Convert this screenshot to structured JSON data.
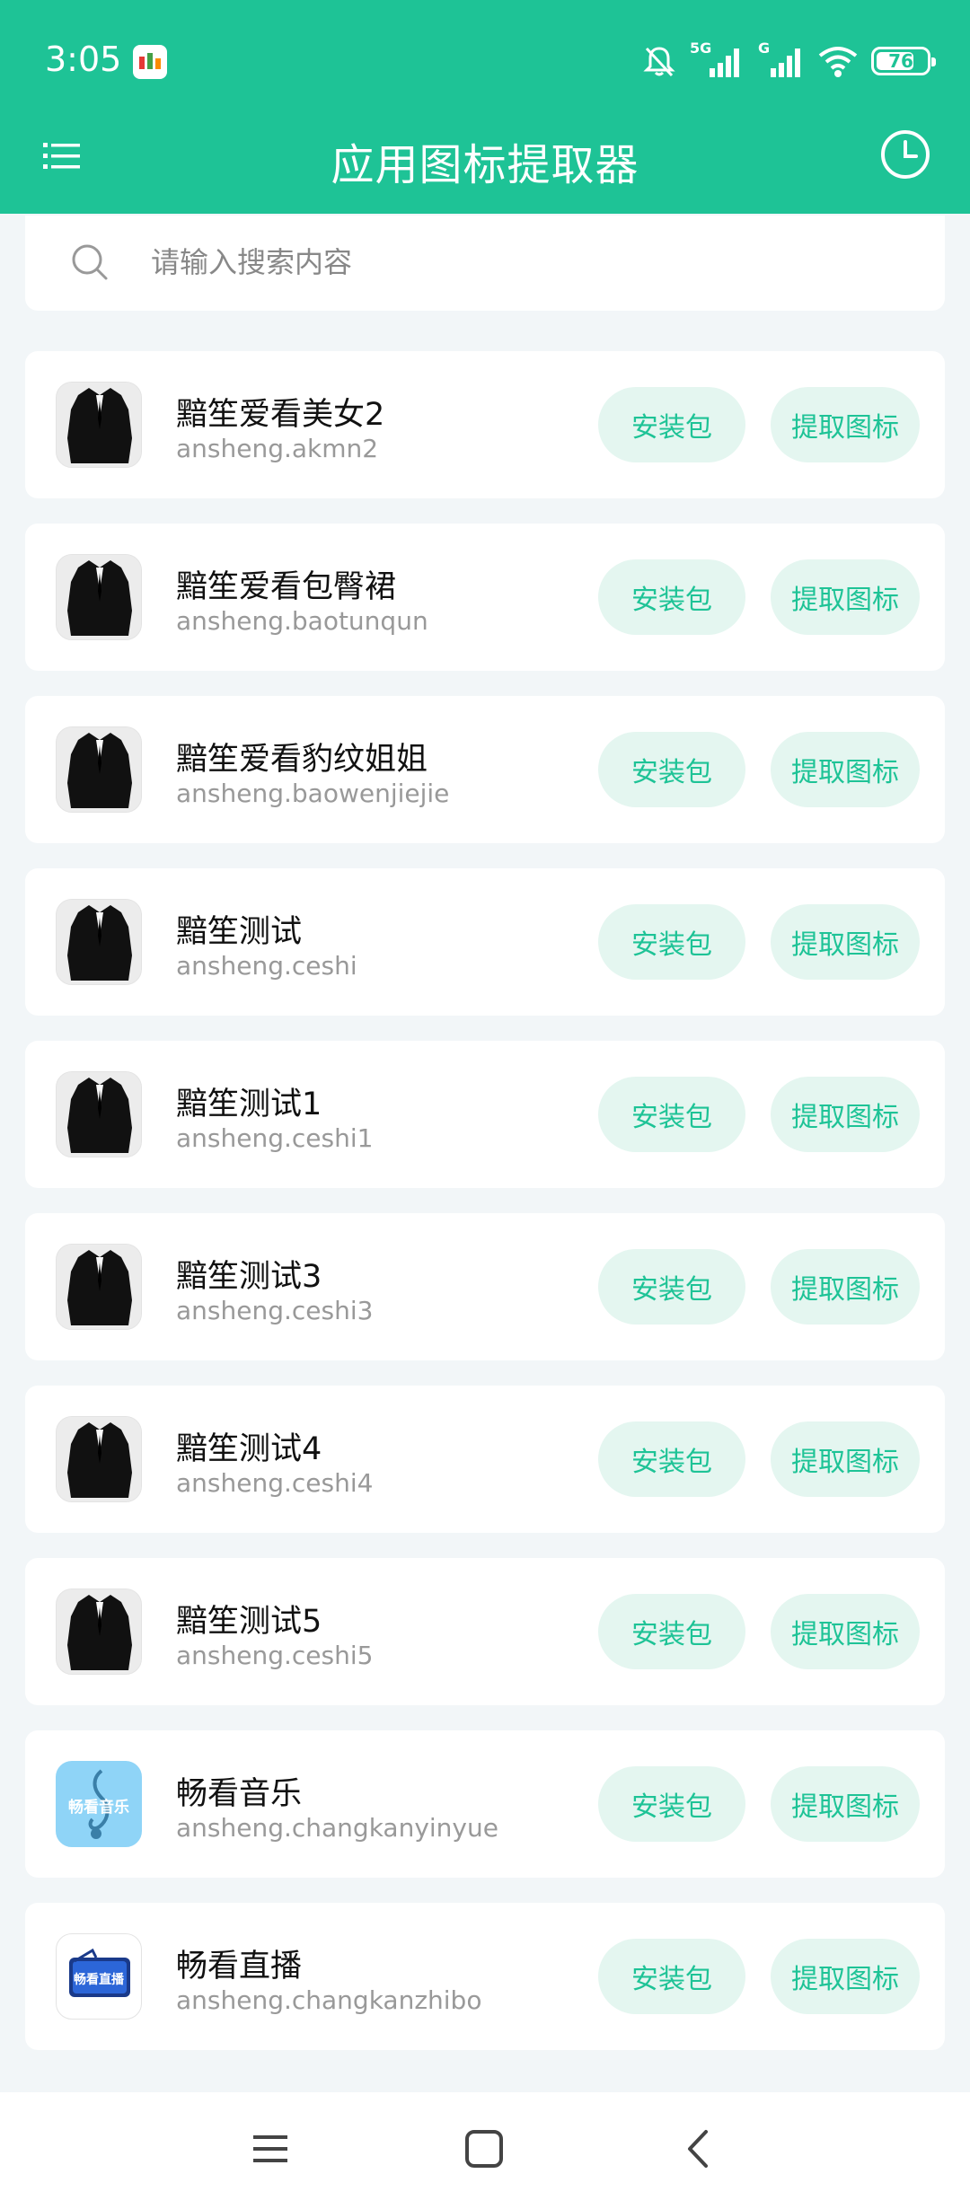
{
  "status_bar": {
    "time": "3:05",
    "battery": "76",
    "network_1": "5G",
    "network_2": "G",
    "icons": [
      "notification-app-icon",
      "bell-muted-icon",
      "signal-5g-icon",
      "signal-g-icon",
      "wifi-icon",
      "battery-icon"
    ]
  },
  "toolbar": {
    "title": "应用图标提取器",
    "left_icon": "menu-list-icon",
    "right_icon": "history-clock-icon"
  },
  "search": {
    "placeholder": "请输入搜索内容",
    "value": ""
  },
  "labels": {
    "apk_button": "安装包",
    "extract_button": "提取图标"
  },
  "apps": [
    {
      "name": "黯笙爱看美女2",
      "package": "ansheng.akmn2",
      "icon": "suit"
    },
    {
      "name": "黯笙爱看包臀裙",
      "package": "ansheng.baotunqun",
      "icon": "suit"
    },
    {
      "name": "黯笙爱看豹纹姐姐",
      "package": "ansheng.baowenjiejie",
      "icon": "suit"
    },
    {
      "name": "黯笙测试",
      "package": "ansheng.ceshi",
      "icon": "suit"
    },
    {
      "name": "黯笙测试1",
      "package": "ansheng.ceshi1",
      "icon": "suit"
    },
    {
      "name": "黯笙测试3",
      "package": "ansheng.ceshi3",
      "icon": "suit"
    },
    {
      "name": "黯笙测试4",
      "package": "ansheng.ceshi4",
      "icon": "suit"
    },
    {
      "name": "黯笙测试5",
      "package": "ansheng.ceshi5",
      "icon": "suit"
    },
    {
      "name": "畅看音乐",
      "package": "ansheng.changkanyinyue",
      "icon": "music",
      "icon_text": "畅看音乐"
    },
    {
      "name": "畅看直播",
      "package": "ansheng.changkanzhibo",
      "icon": "live",
      "icon_text": "畅看直播"
    }
  ],
  "colors": {
    "primary": "#1ec396",
    "button_bg": "#e4f6f0",
    "page_bg": "#f2f6f8"
  },
  "nav_bar": {
    "icons": [
      "recent-apps-icon",
      "home-icon",
      "back-icon"
    ]
  }
}
